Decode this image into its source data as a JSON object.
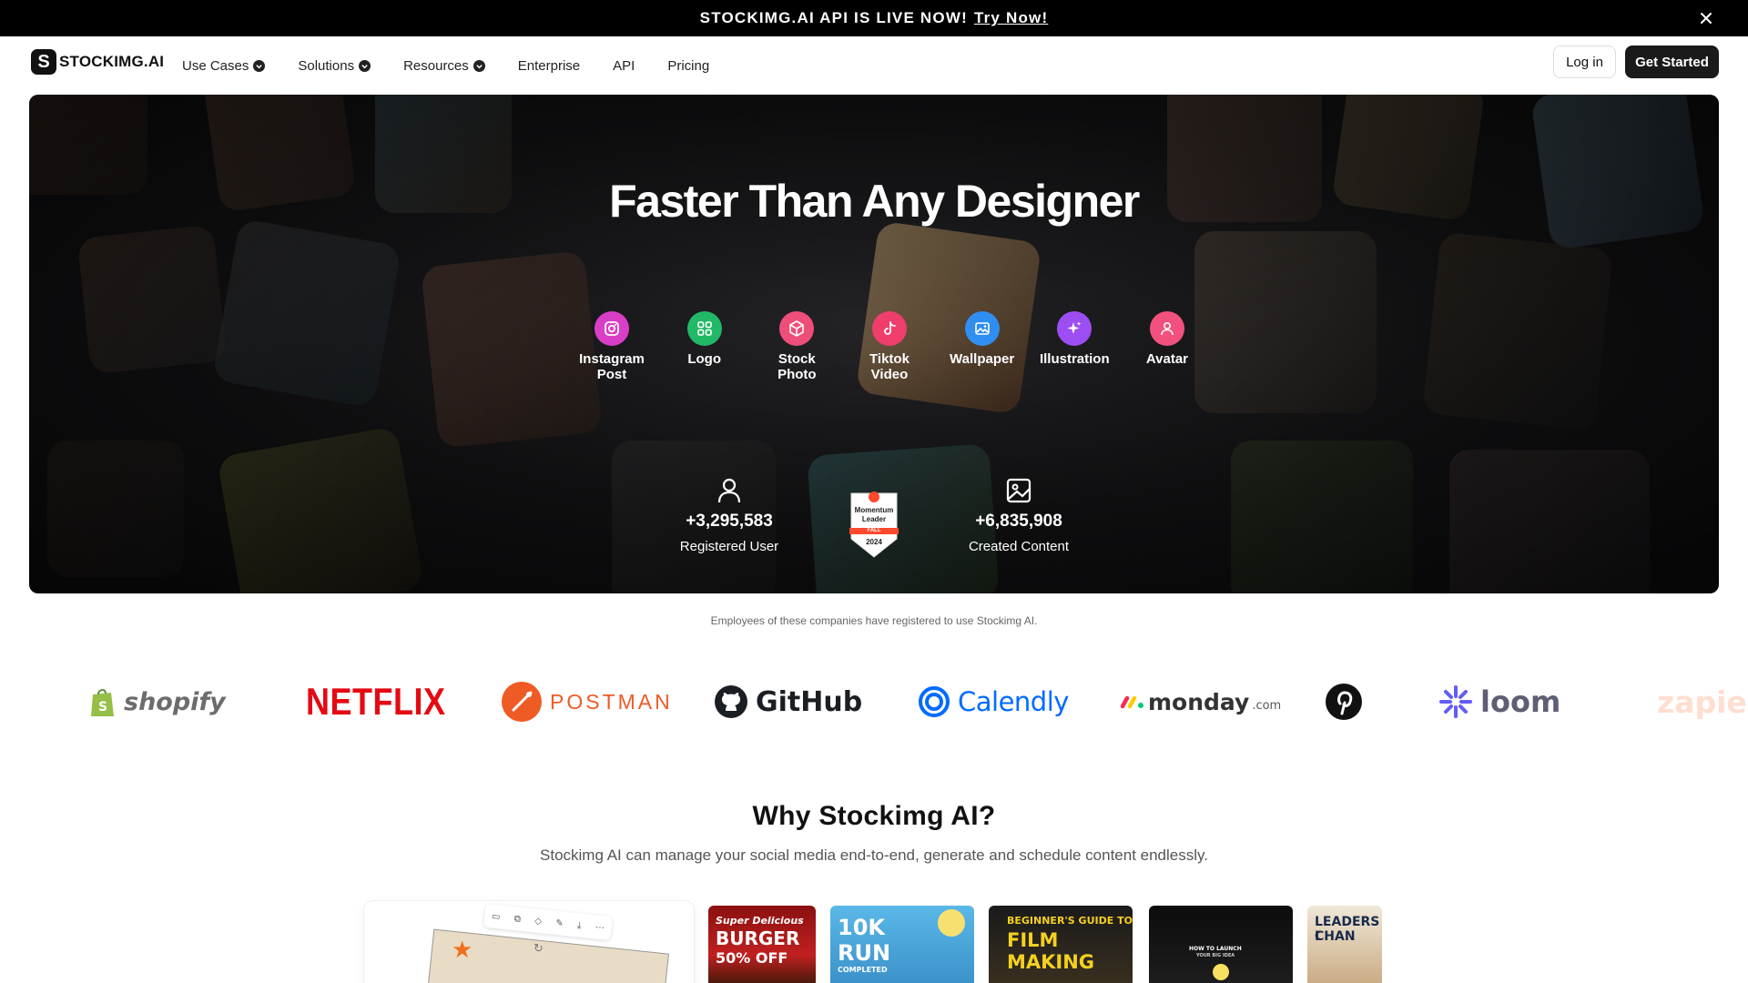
{
  "announcement": {
    "text": "STOCKIMG.AI API IS LIVE NOW!",
    "link": "Try Now!"
  },
  "nav": {
    "brand": "STOCKIMG.AI",
    "items": [
      "Use Cases",
      "Solutions",
      "Resources",
      "Enterprise",
      "API",
      "Pricing"
    ],
    "login": "Log in",
    "get_started": "Get Started"
  },
  "hero": {
    "title": "Faster Than Any Designer",
    "categories": [
      {
        "label": "Instagram\nPost",
        "icon": "instagram-icon",
        "color": "#d93ec7"
      },
      {
        "label": "Logo",
        "icon": "grid-icon",
        "color": "#22b866"
      },
      {
        "label": "Stock\nPhoto",
        "icon": "box-icon",
        "color": "#ef4e7a"
      },
      {
        "label": "Tiktok\nVideo",
        "icon": "tiktok-icon",
        "color": "#ef3e6c"
      },
      {
        "label": "Wallpaper",
        "icon": "image-icon",
        "color": "#2f8ef0"
      },
      {
        "label": "Illustration",
        "icon": "sparkle-icon",
        "color": "#9d4ef2"
      },
      {
        "label": "Avatar",
        "icon": "person-icon",
        "color": "#f2517d"
      }
    ],
    "stats": {
      "users_value": "+3,295,583",
      "users_label": "Registered User",
      "content_value": "+6,835,908",
      "content_label": "Created Content"
    },
    "badge": {
      "top": "Momentum",
      "mid": "Leader",
      "season": "FALL",
      "year": "2024"
    }
  },
  "companies": {
    "caption": "Employees of these companies have registered to use Stockimg AI.",
    "logos": [
      "shopify",
      "NETFLIX",
      "POSTMAN",
      "GitHub",
      "Calendly",
      "monday",
      ".com",
      "loom",
      "zapie"
    ]
  },
  "why": {
    "title": "Why Stockimg AI?",
    "subtitle": "Stockimg AI can manage your social media end-to-end, generate and schedule content endlessly."
  },
  "thumbnails": {
    "t1_line1": "Super Delicious",
    "t1_line2": "BURGER",
    "t1_line3": "50% OFF",
    "t2_line1": "10K",
    "t2_line2": "RUN",
    "t2_line3": "COMPLETED",
    "t3_line1": "BEGINNER'S GUIDE TO",
    "t3_line2": "FILM MAKING",
    "t4_line1": "HOW TO LAUNCH",
    "t4_line2": "YOUR BIG IDEA",
    "t5_line1": "LEADERS I",
    "t5_line2": "CHAN"
  },
  "colors": {
    "netflix": "#e50914",
    "postman": "#ef5b25",
    "calendly": "#006bff",
    "loom": "#625df5"
  }
}
